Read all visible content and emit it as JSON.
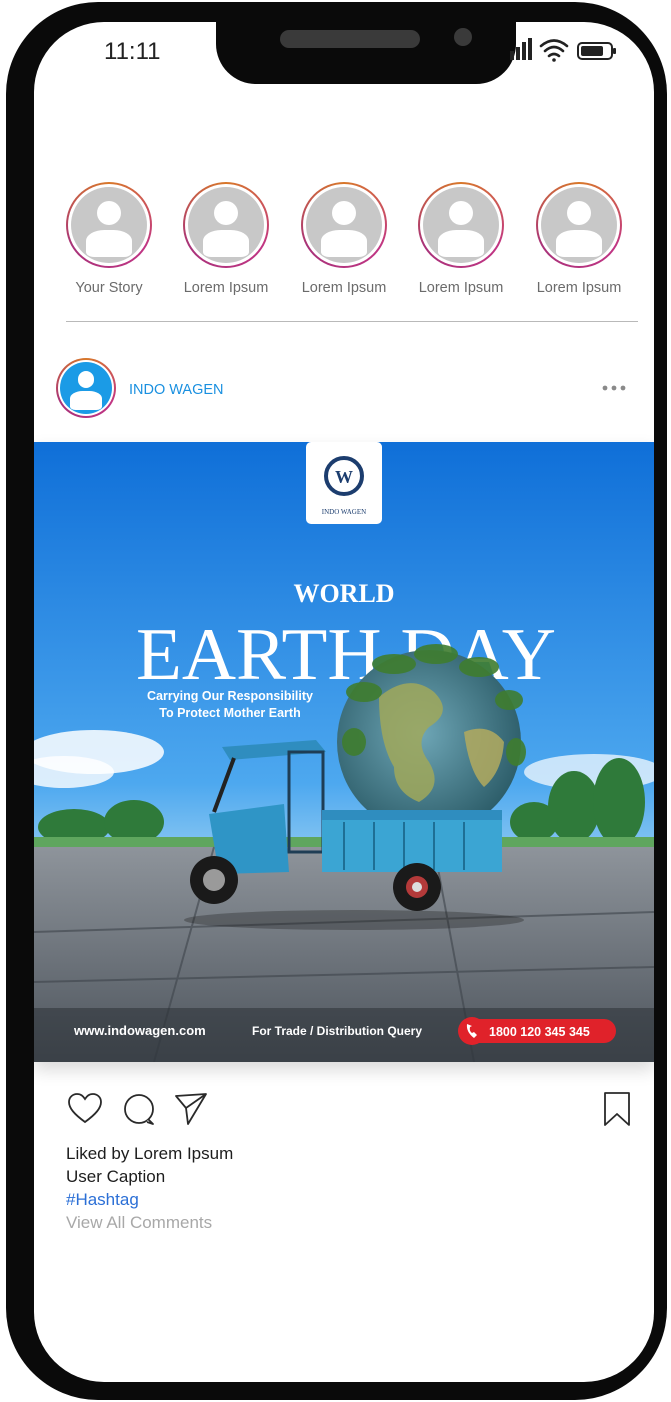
{
  "status_bar": {
    "time": "11:11"
  },
  "stories": [
    {
      "label": "Your Story"
    },
    {
      "label": "Lorem Ipsum"
    },
    {
      "label": "Lorem Ipsum"
    },
    {
      "label": "Lorem Ipsum"
    },
    {
      "label": "Lorem Ipsum"
    }
  ],
  "post": {
    "username": "INDO WAGEN",
    "image": {
      "logo_text": "INDO WAGEN",
      "logo_letter": "W",
      "headline_small": "WORLD",
      "headline_large": "EARTH DAY",
      "subtitle_line1": "Carrying Our Responsibility",
      "subtitle_line2": "To Protect Mother Earth",
      "website": "www.indowagen.com",
      "trade_text": "For Trade / Distribution Query",
      "phone": "1800 120 345 345"
    },
    "liked_by": "Liked by Lorem Ipsum",
    "caption": "User Caption",
    "hashtag": "#Hashtag",
    "view_comments": "View All Comments"
  },
  "colors": {
    "frame": "#0a0a0a",
    "username": "#1a90e0",
    "hashtag": "#2b6fd6",
    "muted": "#a8a8a8",
    "story_ring_start": "#d8782a",
    "story_ring_end": "#c13584"
  },
  "icons": [
    "signal-icon",
    "wifi-icon",
    "battery-icon",
    "more-options-icon",
    "heart-icon",
    "comment-icon",
    "share-icon",
    "bookmark-icon"
  ]
}
